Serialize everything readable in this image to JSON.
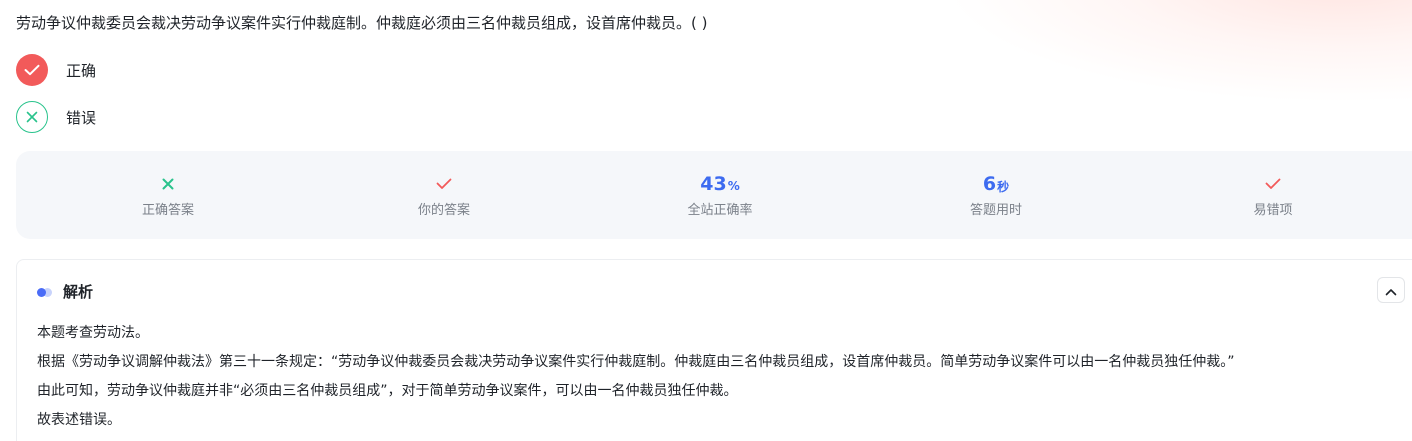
{
  "question": {
    "text": "劳动争议仲裁委员会裁决劳动争议案件实行仲裁庭制。仲裁庭必须由三名仲裁员组成，设首席仲裁员。( )"
  },
  "options": [
    {
      "label": "正确",
      "icon": "check-icon",
      "state": "selected"
    },
    {
      "label": "错误",
      "icon": "cross-icon",
      "state": "correct-answer"
    }
  ],
  "stats": {
    "correct_answer": {
      "caption": "正确答案",
      "icon": "cross-icon",
      "color": "#29c38c"
    },
    "your_answer": {
      "caption": "你的答案",
      "icon": "check-icon",
      "color": "#f25a5a"
    },
    "accuracy": {
      "value": "43",
      "unit": "%",
      "caption": "全站正确率"
    },
    "time": {
      "value": "6",
      "unit": "秒",
      "caption": "答题用时"
    },
    "error_prone": {
      "caption": "易错项",
      "icon": "check-icon",
      "color": "#f25a5a"
    }
  },
  "analysis": {
    "title": "解析",
    "lines": [
      "本题考查劳动法。",
      "根据《劳动争议调解仲裁法》第三十一条规定：“劳动争议仲裁委员会裁决劳动争议案件实行仲裁庭制。仲裁庭由三名仲裁员组成，设首席仲裁员。简单劳动争议案件可以由一名仲裁员独任仲裁。”",
      "由此可知，劳动争议仲裁庭并非“必须由三名仲裁员组成”，对于简单劳动争议案件，可以由一名仲裁员独任仲裁。",
      "故表述错误。"
    ]
  },
  "colors": {
    "accent_blue": "#3d6bf0",
    "wrong_red": "#f25a5a",
    "right_green": "#29c38c"
  }
}
